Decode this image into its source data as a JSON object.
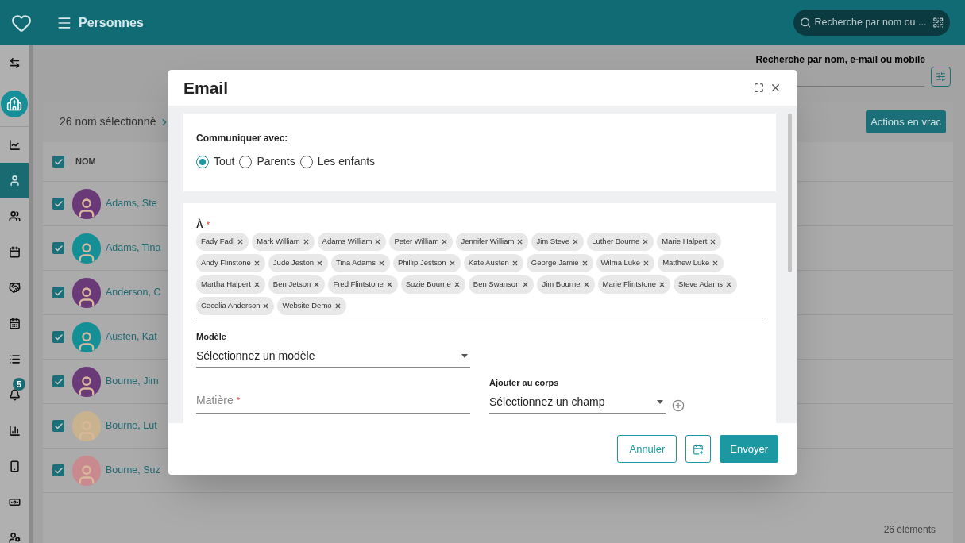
{
  "app_bar": {
    "title": "Personnes",
    "search": {
      "placeholder": "Recherche par nom ou ..."
    }
  },
  "sidebar": {
    "items": [
      {
        "selected": false
      },
      {
        "selected": false
      },
      {
        "selected": false
      },
      {
        "selected": true
      },
      {
        "selected": false
      },
      {
        "selected": false
      },
      {
        "selected": false
      },
      {
        "selected": false
      },
      {
        "selected": false
      },
      {
        "selected": false,
        "badge": "5"
      },
      {
        "selected": false
      },
      {
        "selected": false
      },
      {
        "selected": false
      },
      {
        "selected": false
      }
    ]
  },
  "filter": {
    "label": "Recherche par nom, e-mail ou mobile"
  },
  "selection_bar": {
    "text": "26 nom sélectionné",
    "bulk_button": "Actions en vrac"
  },
  "table": {
    "columns": [
      "NOM"
    ],
    "header_checked": true,
    "rows": [
      {
        "name": "Adams, Ste",
        "checked": true,
        "color": "#6a3a78"
      },
      {
        "name": "Adams, Tina",
        "checked": true,
        "color": "#138f95"
      },
      {
        "name": "Anderson, C",
        "checked": true,
        "color": "#6a3a78"
      },
      {
        "name": "Austen, Kat",
        "checked": true,
        "color": "#138f95"
      },
      {
        "name": "Bourne, Jim",
        "checked": true,
        "color": "#6a3a78"
      },
      {
        "name": "Bourne, Lut",
        "checked": true,
        "color": "#c9b38f"
      },
      {
        "name": "Bourne, Suz",
        "checked": true,
        "color": "#c98a8f"
      }
    ],
    "footer": "26 éléments"
  },
  "dialog": {
    "title": "Email",
    "audience": {
      "label": "Communiquer avec:",
      "options": [
        {
          "label": "Tout",
          "selected": true
        },
        {
          "label": "Parents",
          "selected": false
        },
        {
          "label": "Les enfants",
          "selected": false
        }
      ]
    },
    "recipients": {
      "label": "À",
      "required_mark": "*",
      "chips": [
        "Fady Fadl",
        "Mark William",
        "Adams William",
        "Peter William",
        "Jennifer William",
        "Jim Steve",
        "Luther Bourne",
        "Marie Halpert",
        "Andy Flinstone",
        "Jude Jeston",
        "Tina Adams",
        "Phillip Jestson",
        "Kate Austen",
        "George Jamie",
        "Wilma Luke",
        "Matthew Luke",
        "Martha Halpert",
        "Ben Jetson",
        "Fred Flintstone",
        "Suzie Bourne",
        "Ben Swanson",
        "Jim Bourne",
        "Marie Flintstone",
        "Steve Adams",
        "Cecelia Anderson",
        "Website Demo"
      ]
    },
    "template": {
      "label": "Modèle",
      "value": "Sélectionnez un modèle"
    },
    "subject": {
      "placeholder": "Matière",
      "required_mark": "*"
    },
    "insert_field": {
      "label": "Ajouter au corps",
      "value": "Sélectionnez un champ"
    },
    "buttons": {
      "cancel": "Annuler",
      "send": "Envoyer"
    }
  }
}
